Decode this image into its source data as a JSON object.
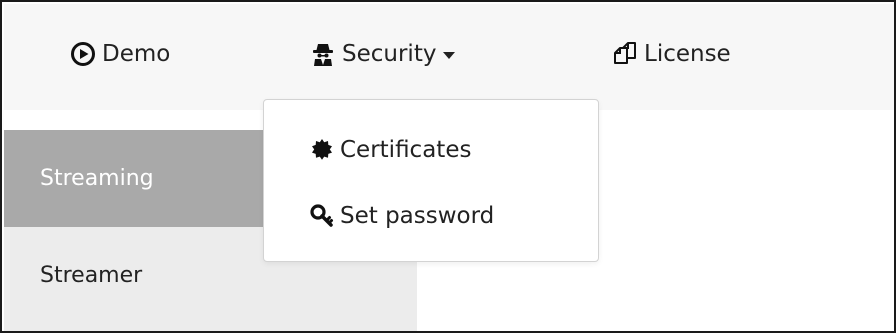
{
  "navbar": {
    "items": [
      {
        "label": "Demo",
        "icon": "play-circle-icon"
      },
      {
        "label": "Security",
        "icon": "spy-icon"
      },
      {
        "label": "License",
        "icon": "copy-icon"
      }
    ]
  },
  "dropdown": {
    "items": [
      {
        "label": "Certificates",
        "icon": "certificate-icon"
      },
      {
        "label": "Set password",
        "icon": "key-icon"
      }
    ]
  },
  "sidebar": {
    "items": [
      {
        "label": "Streaming",
        "active": true
      },
      {
        "label": "Streamer",
        "active": false
      }
    ]
  },
  "colors": {
    "navbar_bg": "#f7f7f7",
    "sidebar_bg": "#ececec",
    "sidebar_active_bg": "#a9a9a9",
    "text": "#222222",
    "active_text": "#ffffff"
  }
}
